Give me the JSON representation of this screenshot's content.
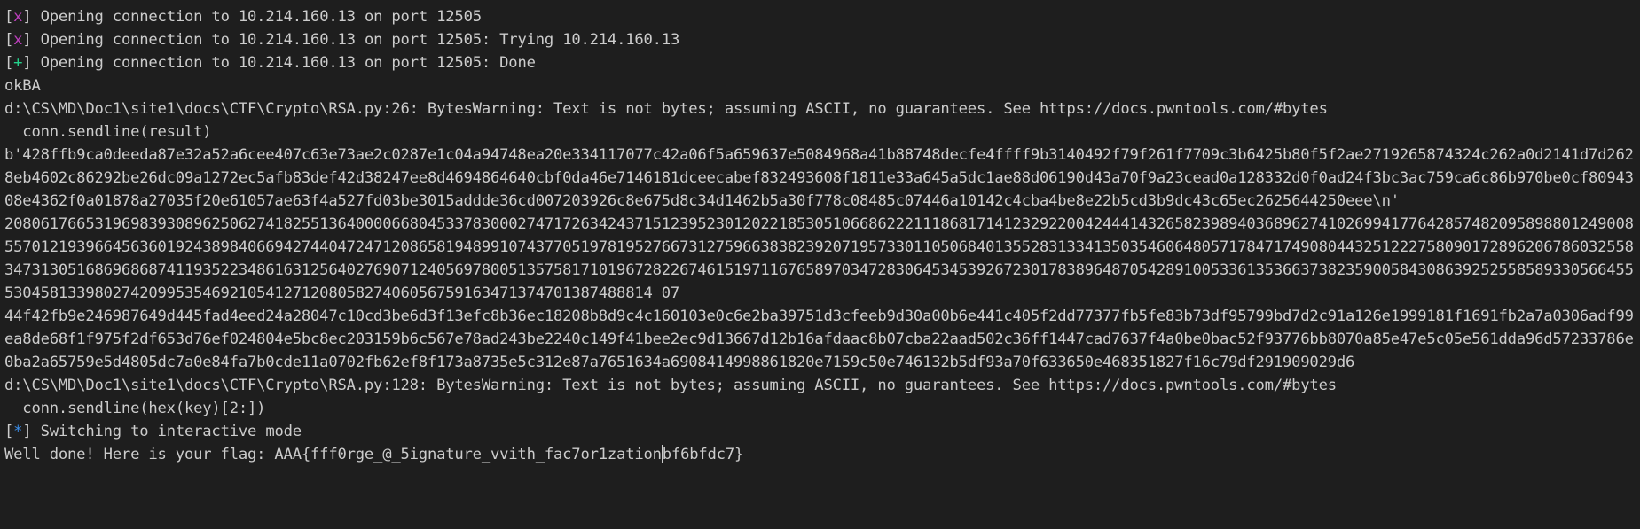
{
  "terminal": {
    "top_clipped": {
      "part1": "                                ",
      "part2": ""
    },
    "lines": [
      {
        "kind": "status",
        "mark": "x",
        "text": "Opening connection to 10.214.160.13 on port 12505"
      },
      {
        "kind": "status",
        "mark": "x",
        "text": "Opening connection to 10.214.160.13 on port 12505: Trying 10.214.160.13"
      },
      {
        "kind": "status",
        "mark": "+",
        "text": "Opening connection to 10.214.160.13 on port 12505: Done"
      },
      {
        "kind": "plain",
        "text": "okBA"
      },
      {
        "kind": "plain",
        "text": "d:\\CS\\MD\\Doc1\\site1\\docs\\CTF\\Crypto\\RSA.py:26: BytesWarning: Text is not bytes; assuming ASCII, no guarantees. See https://docs.pwntools.com/#bytes"
      },
      {
        "kind": "plain",
        "text": "  conn.sendline(result)"
      },
      {
        "kind": "wrap",
        "text": "b'428ffb9ca0deeda87e32a52a6cee407c63e73ae2c0287e1c04a94748ea20e334117077c42a06f5a659637e5084968a41b88748decfe4ffff9b3140492f79f261f7709c3b6425b80f5f2ae2719265874324c262a0d2141d7d2628eb4602c86292be26dc09a1272ec5afb83def42d38247ee8d4694864640cbf0da46e7146181dceecabef832493608f1811e33a645a5dc1ae88d06190d43a70f9a23cead0a128332d0f0ad24f3bc3ac759ca6c86b970be0cf8094308e4362f0a01878a27035f20e61057ae63f4a527fd03be3015addde36cd007203926c8e675d8c34d1462b5a30f778c08485c07446a10142c4cba4be8e22b5cd3b9dc43c65ec2625644250eee\\n'"
      },
      {
        "kind": "wrap",
        "text": "208061766531969839308962506274182551364000066804533783000274717263424371512395230120221853051066862221118681714123292200424441432658239894036896274102699417764285748209589880124900855701219396645636019243898406694274404724712086581948991074377051978195276673127596638382392071957330110506840135528313341350354606480571784717490804432512227580901728962067860325583473130516869686874119352234861631256402769071240569780051357581710196728226746151971167658970347283064534539267230178389648705428910053361353663738235900584308639252558589330566455530458133980274209953546921054127120805827406056759163471374701387488814 07"
      },
      {
        "kind": "wrap",
        "text": "44f42fb9e246987649d445fad4eed24a28047c10cd3be6d3f13efc8b36ec18208b8d9c4c160103e0c6e2ba39751d3cfeeb9d30a00b6e441c405f2dd77377fb5fe83b73df95799bd7d2c91a126e1999181f1691fb2a7a0306adf99ea8de68f1f975f2df653d76ef024804e5bc8ec203159b6c567e78ad243be2240c149f41bee2ec9d13667d12b16afdaac8b07cba22aad502c36ff1447cad7637f4a0be0bac52f93776bb8070a85e47e5c05e561dda96d57233786e0ba2a65759e5d4805dc7a0e84fa7b0cde11a0702fb62ef8f173a8735e5c312e87a7651634a6908414998861820e7159c50e746132b5df93a70f633650e468351827f16c79df291909029d6"
      },
      {
        "kind": "plain",
        "text": "d:\\CS\\MD\\Doc1\\site1\\docs\\CTF\\Crypto\\RSA.py:128: BytesWarning: Text is not bytes; assuming ASCII, no guarantees. See https://docs.pwntools.com/#bytes"
      },
      {
        "kind": "plain",
        "text": "  conn.sendline(hex(key)[2:])"
      },
      {
        "kind": "status",
        "mark": "*",
        "text": "Switching to interactive mode"
      },
      {
        "kind": "flag",
        "before": "Well done! Here is your flag: AAA{fff0rge_@_5ignature_vvith_fac7or1zation",
        "after": "bf6bfdc7}"
      }
    ]
  }
}
